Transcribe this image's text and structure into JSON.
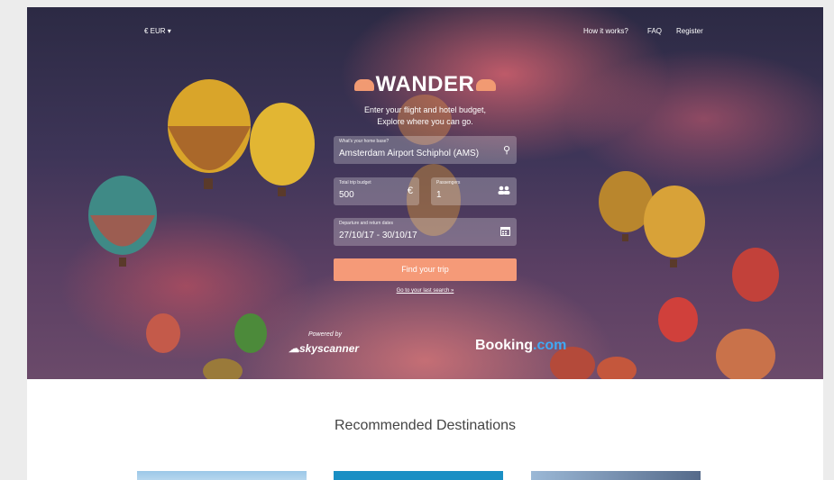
{
  "nav": {
    "currency": "€ EUR ▾",
    "how_it_works": "How it works?",
    "faq": "FAQ",
    "register": "Register"
  },
  "brand": {
    "name": "WANDER",
    "tagline_1": "Enter your flight and hotel budget,",
    "tagline_2": "Explore where you can go."
  },
  "form": {
    "home_label": "What's your home base?",
    "home_value": "Amsterdam Airport Schiphol (AMS)",
    "budget_label": "Total trip budget",
    "budget_value": "500",
    "budget_icon": "€",
    "passengers_label": "Passengers",
    "passengers_value": "1",
    "dates_label": "Departure and return dates",
    "dates_value": "27/10/17 - 30/10/17",
    "submit": "Find your trip",
    "last_search": "Go to your last search »"
  },
  "partners": {
    "powered_by": "Powered by",
    "skyscanner": "skyscanner",
    "booking_1": "Booking",
    "booking_2": ".com"
  },
  "section": {
    "title": "Recommended Destinations"
  },
  "colors": {
    "accent": "#f59a78",
    "booking_blue": "#3fa9f5"
  }
}
